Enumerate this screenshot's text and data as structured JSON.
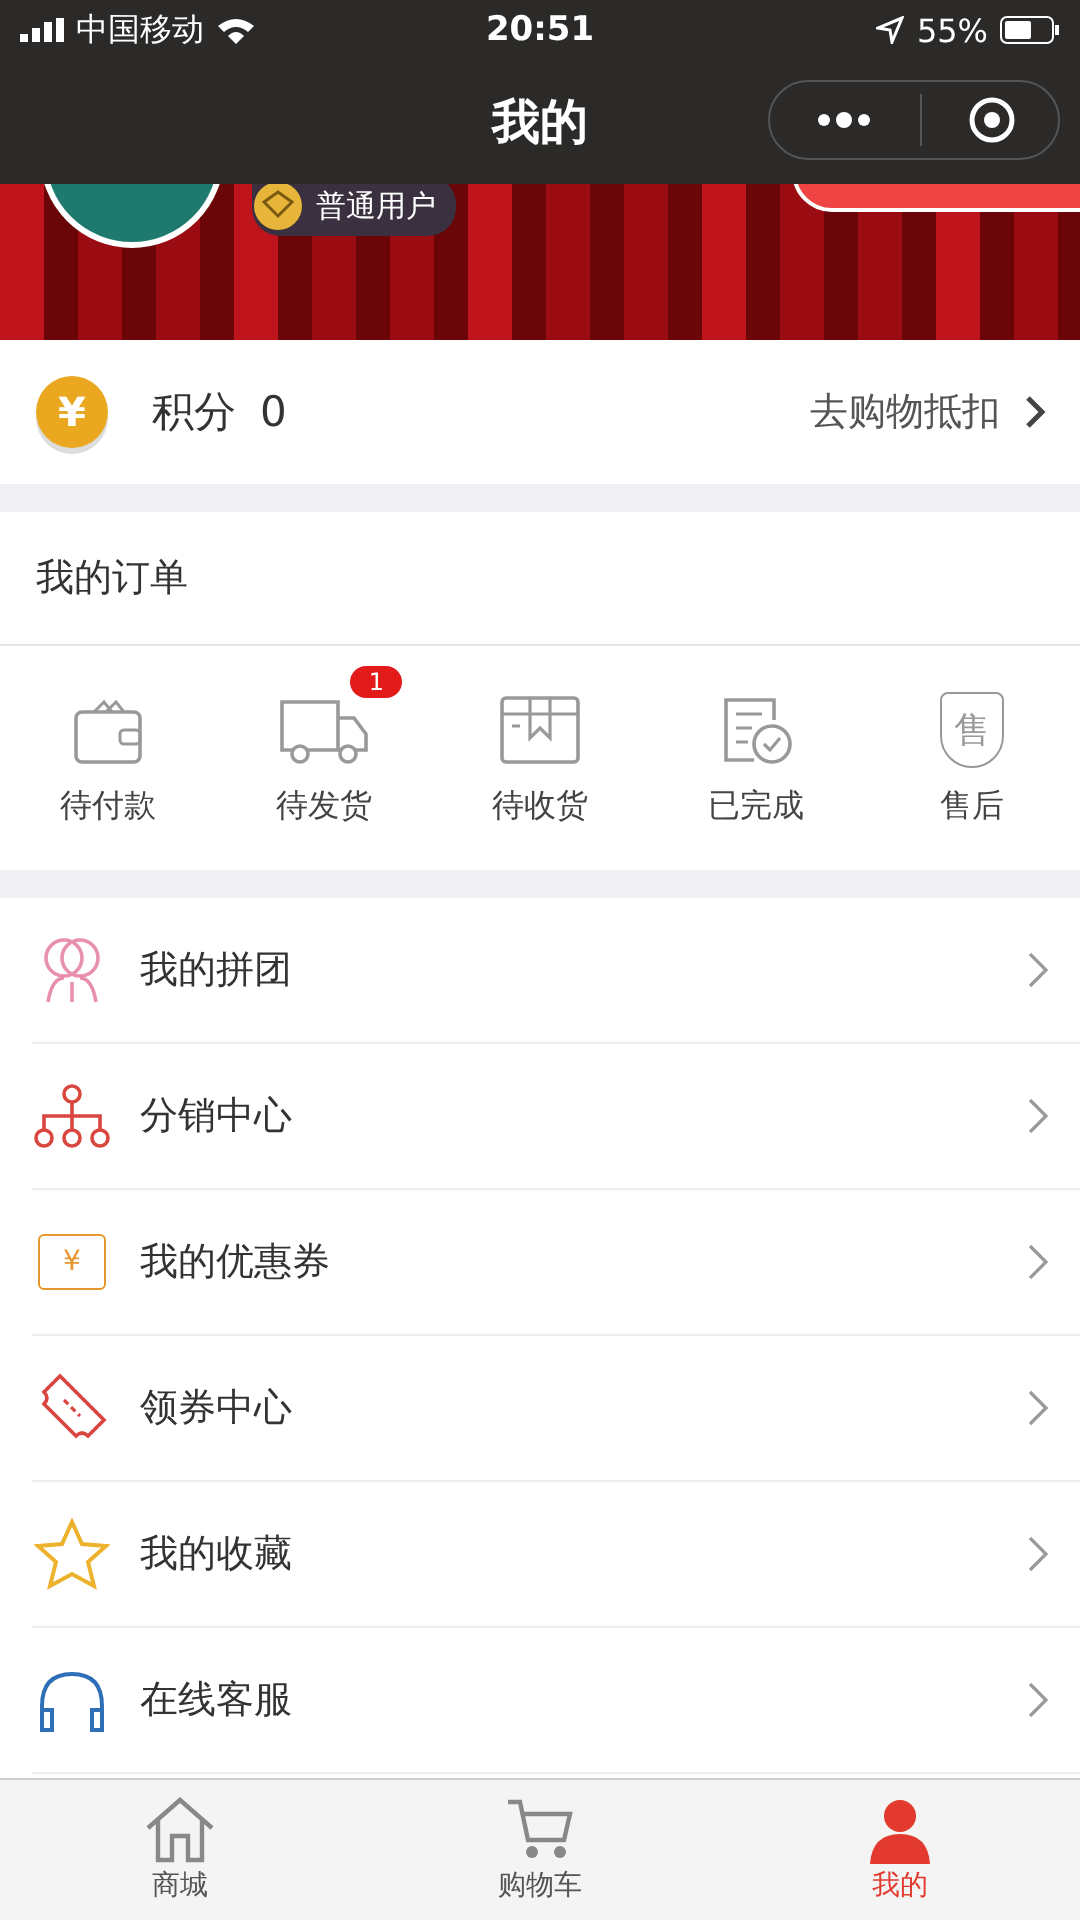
{
  "status_bar": {
    "carrier": "中国移动",
    "time": "20:51",
    "battery": "55%"
  },
  "nav": {
    "title": "我的"
  },
  "profile": {
    "kind": "picture",
    "badge": "普通用户"
  },
  "points": {
    "icon": "¥",
    "label": "积分",
    "value": "0",
    "link": "去购物抵扣"
  },
  "orders": {
    "title": "我的订单",
    "items": [
      {
        "kind": "wallet",
        "label": "待付款"
      },
      {
        "kind": "truck",
        "label": "待发货",
        "badge": "1"
      },
      {
        "kind": "box",
        "label": "待收货"
      },
      {
        "kind": "done",
        "label": "已完成"
      },
      {
        "kind": "service",
        "label": "售后",
        "glyph": "售"
      }
    ]
  },
  "menu": [
    {
      "kind": "group",
      "label": "我的拼团"
    },
    {
      "kind": "share",
      "label": "分销中心"
    },
    {
      "kind": "coupon",
      "label": "我的优惠券",
      "glyph": "¥"
    },
    {
      "kind": "ticket",
      "label": "领券中心"
    },
    {
      "kind": "star",
      "label": "我的收藏"
    },
    {
      "kind": "headset",
      "label": "在线客服"
    }
  ],
  "tab_bar": [
    {
      "kind": "home",
      "label": "商城",
      "selected": false
    },
    {
      "kind": "cart",
      "label": "购物车",
      "selected": false
    },
    {
      "kind": "person",
      "label": "我的",
      "selected": true
    }
  ]
}
